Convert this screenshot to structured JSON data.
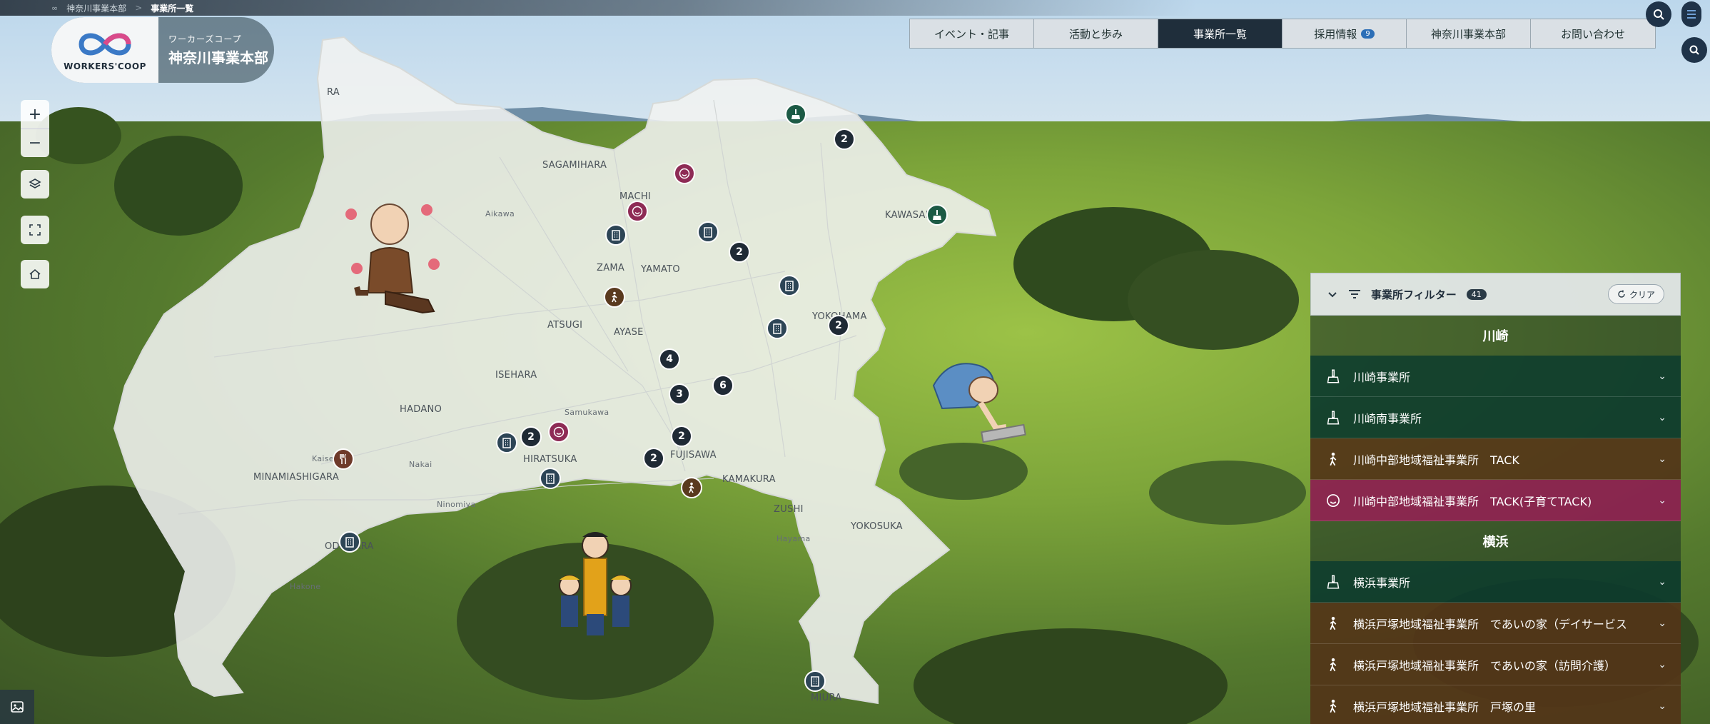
{
  "breadcrumb": {
    "home": "神奈川事業本部",
    "separator": ">",
    "current": "事業所一覧"
  },
  "logo": {
    "sub": "ワーカーズコープ",
    "name": "神奈川事業本部",
    "wordmark": "WORKERS'COOP"
  },
  "nav": {
    "items": [
      {
        "label": "イベント・記事"
      },
      {
        "label": "活動と歩み"
      },
      {
        "label": "事業所一覧"
      },
      {
        "label": "採用情報",
        "badge": "9"
      },
      {
        "label": "神奈川事業本部"
      },
      {
        "label": "お問い合わせ"
      }
    ],
    "active": "事業所一覧"
  },
  "map_controls": {
    "zoom_in": "+",
    "zoom_out": "−"
  },
  "place_labels": [
    {
      "text": "SAGAMIHARA"
    },
    {
      "text": "MACHI"
    },
    {
      "text": "Aikawa"
    },
    {
      "text": "ZAMA"
    },
    {
      "text": "YAMATO"
    },
    {
      "text": "KAWASAKI"
    },
    {
      "text": "ATSUGI"
    },
    {
      "text": "AYASE"
    },
    {
      "text": "YOKOHAMA"
    },
    {
      "text": "ISEHARA"
    },
    {
      "text": "HADANO"
    },
    {
      "text": "Samukawa"
    },
    {
      "text": "HIRATSUKA"
    },
    {
      "text": "FUJISAWA"
    },
    {
      "text": "KAMAKURA"
    },
    {
      "text": "ZUSHI"
    },
    {
      "text": "Kaisei"
    },
    {
      "text": "MINAMIASHIGARA"
    },
    {
      "text": "Nakai"
    },
    {
      "text": "Ninomiya"
    },
    {
      "text": "ODAWARA"
    },
    {
      "text": "Hayama"
    },
    {
      "text": "YOKOSUKA"
    },
    {
      "text": "Hakone"
    },
    {
      "text": "MIURA"
    },
    {
      "text": "RA"
    }
  ],
  "clusters": [
    "2",
    "2",
    "2",
    "4",
    "3",
    "6",
    "2",
    "2",
    "2"
  ],
  "markers": [
    {
      "icon": "broom-icon",
      "color": "#1c5a45"
    },
    {
      "icon": "smile-icon",
      "color": "#8e2b55"
    },
    {
      "icon": "smile-icon",
      "color": "#8e2b55"
    },
    {
      "icon": "building-icon",
      "color": "#2d4556"
    },
    {
      "icon": "building-icon",
      "color": "#2d4556"
    },
    {
      "icon": "broom-icon",
      "color": "#1c5a45"
    },
    {
      "icon": "walker-icon",
      "color": "#5a3a1e"
    },
    {
      "icon": "building-icon",
      "color": "#2d4556"
    },
    {
      "icon": "building-icon",
      "color": "#2d4556"
    },
    {
      "icon": "building-icon",
      "color": "#2d4556"
    },
    {
      "icon": "smile-icon",
      "color": "#8e2b55"
    },
    {
      "icon": "building-icon",
      "color": "#2d4556"
    },
    {
      "icon": "fork-knife-icon",
      "color": "#6e3a2a"
    },
    {
      "icon": "walker-icon",
      "color": "#5a3a1e"
    },
    {
      "icon": "building-icon",
      "color": "#2d4556"
    },
    {
      "icon": "building-icon",
      "color": "#2d4556"
    }
  ],
  "filter": {
    "title": "事業所フィルター",
    "count": "41",
    "clear_label": "クリア",
    "groups": [
      {
        "name": "川崎",
        "items": [
          {
            "label": "川崎事業所",
            "type": "green",
            "icon": "broom-icon"
          },
          {
            "label": "川崎南事業所",
            "type": "green",
            "icon": "broom-icon"
          },
          {
            "label": "川崎中部地域福祉事業所　TACK",
            "type": "brown",
            "icon": "walker-icon"
          },
          {
            "label": "川崎中部地域福祉事業所　TACK(子育てTACK)",
            "type": "rose",
            "icon": "smile-icon"
          }
        ]
      },
      {
        "name": "横浜",
        "items": [
          {
            "label": "横浜事業所",
            "type": "green",
            "icon": "broom-icon"
          },
          {
            "label": "横浜戸塚地域福祉事業所　であいの家（デイサービス",
            "type": "brown",
            "icon": "walker-icon"
          },
          {
            "label": "横浜戸塚地域福祉事業所　であいの家（訪問介護）",
            "type": "brown",
            "icon": "walker-icon"
          },
          {
            "label": "横浜戸塚地域福祉事業所　戸塚の里",
            "type": "brown",
            "icon": "walker-icon"
          }
        ]
      }
    ]
  },
  "colors": {
    "nav_active": "#1f2e3b",
    "row_green": "#0c3a2d",
    "row_brown": "#523418",
    "row_rose": "#8c1e50",
    "cluster": "#1f2a35"
  }
}
